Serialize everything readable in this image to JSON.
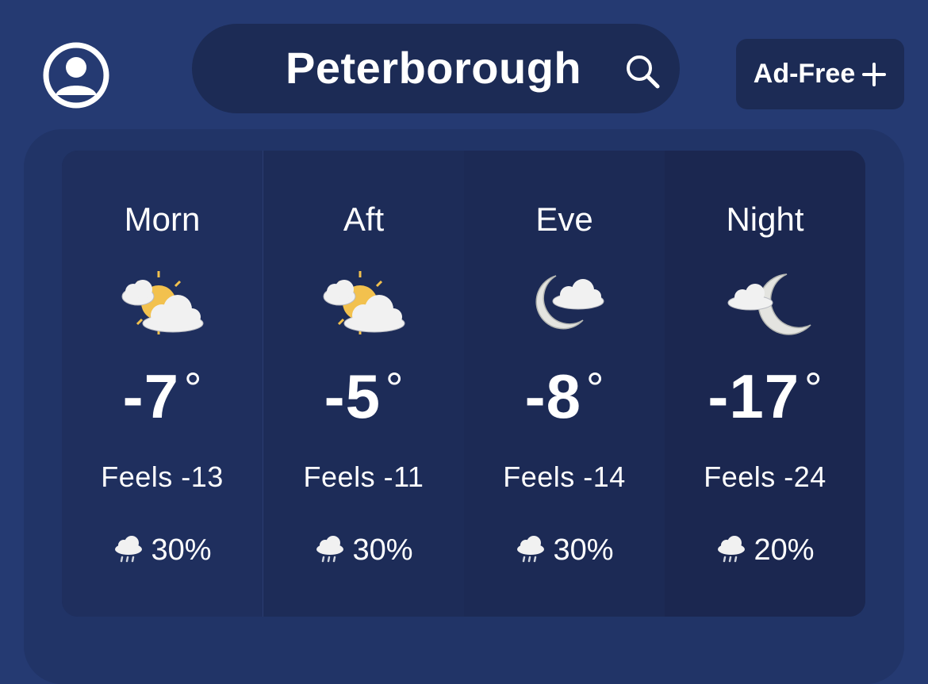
{
  "header": {
    "location": "Peterborough",
    "ad_free_label": "Ad-Free"
  },
  "icons": {
    "profile": "user-circle-icon",
    "search": "search-icon",
    "plus": "plus-icon",
    "rain": "rain-cloud-icon"
  },
  "colors": {
    "background": "#253a72",
    "panel": "#213467",
    "pill": "#1c2b55",
    "sun": "#f2c14e",
    "moon": "#e4e4e0",
    "cloud": "#f1f1f1"
  },
  "periods": [
    {
      "name": "Morn",
      "icon": "partly-cloudy-day-icon",
      "temp": "-7",
      "deg": "°",
      "feels": "Feels -13",
      "precip": "30%"
    },
    {
      "name": "Aft",
      "icon": "partly-cloudy-day-icon",
      "temp": "-5",
      "deg": "°",
      "feels": "Feels -11",
      "precip": "30%"
    },
    {
      "name": "Eve",
      "icon": "partly-cloudy-night-icon",
      "temp": "-8",
      "deg": "°",
      "feels": "Feels -14",
      "precip": "30%"
    },
    {
      "name": "Night",
      "icon": "partly-cloudy-night-icon",
      "temp": "-17",
      "deg": "°",
      "feels": "Feels -24",
      "precip": "20%"
    }
  ]
}
